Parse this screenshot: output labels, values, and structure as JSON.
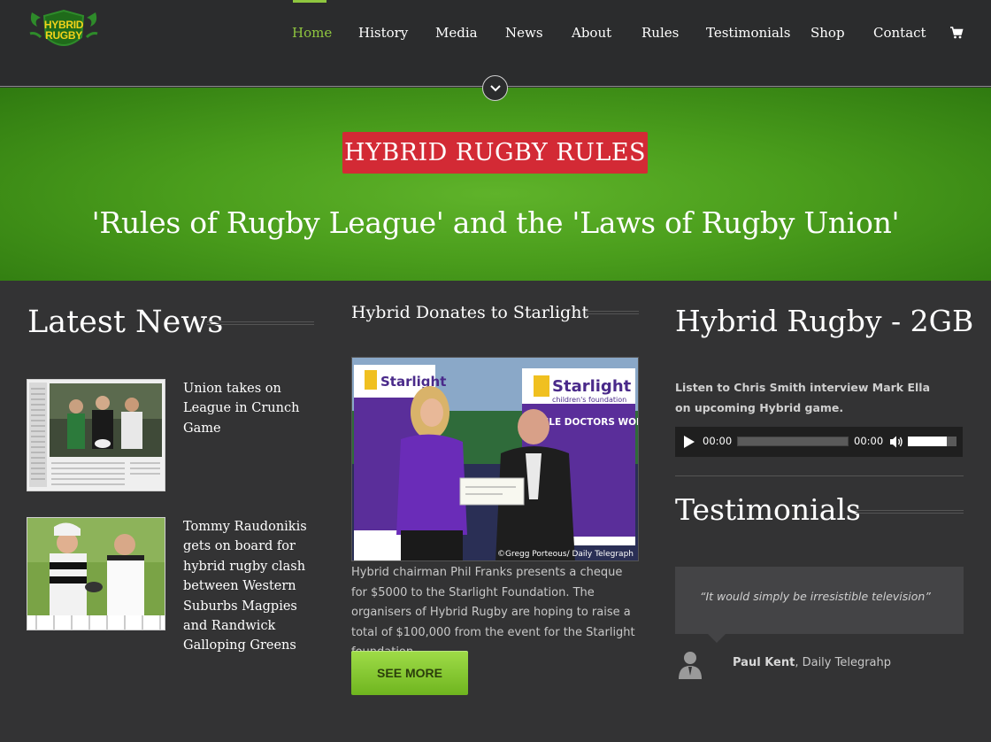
{
  "header": {
    "logo_text_line1": "HYBRID",
    "logo_text_line2": "RUGBY",
    "nav": [
      {
        "label": "Home",
        "active": true
      },
      {
        "label": "History"
      },
      {
        "label": "Media"
      },
      {
        "label": "News"
      },
      {
        "label": "About"
      },
      {
        "label": "Rules"
      },
      {
        "label": "Testimonials"
      },
      {
        "label": "Shop"
      },
      {
        "label": "Contact"
      }
    ],
    "cart_icon": "shopping-cart-icon",
    "accent_color": "#8fc63f"
  },
  "hero": {
    "badge": "HYBRID RUGBY RULES",
    "subtitle": "'Rules of Rugby League' and the 'Laws of Rugby Union'",
    "badge_color": "#d32a35"
  },
  "latest_news": {
    "title": "Latest News",
    "items": [
      {
        "title": "Union takes on League in Crunch Game"
      },
      {
        "title": "Tommy Raudonikis gets on board for hybrid rugby clash between Western Suburbs Magpies and Randwick Galloping Greens"
      }
    ]
  },
  "feature": {
    "title": "Hybrid Donates to Starlight",
    "photo_credit": "©Gregg Porteous/ Daily Telegraph",
    "photo_banner_brand": "Starlight",
    "photo_banner_sub": "children's foundation",
    "photo_banner_text": "WHILE DOCTORS WORK HARD",
    "caption": "Hybrid chairman Phil Franks presents a cheque for $5000 to the Starlight Foundation. The organisers of Hybrid Rugby are hoping to raise a total of $100,000 from the event for the Starlight foundation.",
    "button": "SEE MORE"
  },
  "radio": {
    "title": "Hybrid Rugby - 2GB",
    "description": "Listen to Chris Smith interview Mark Ella on upcoming Hybrid game.",
    "current_time": "00:00",
    "duration": "00:00",
    "progress": 0,
    "volume": 0.8
  },
  "testimonials": {
    "title": "Testimonials",
    "quote": "“It would simply be irresistible television”",
    "author": "Paul Kent",
    "source": ", Daily Telegrahp"
  }
}
